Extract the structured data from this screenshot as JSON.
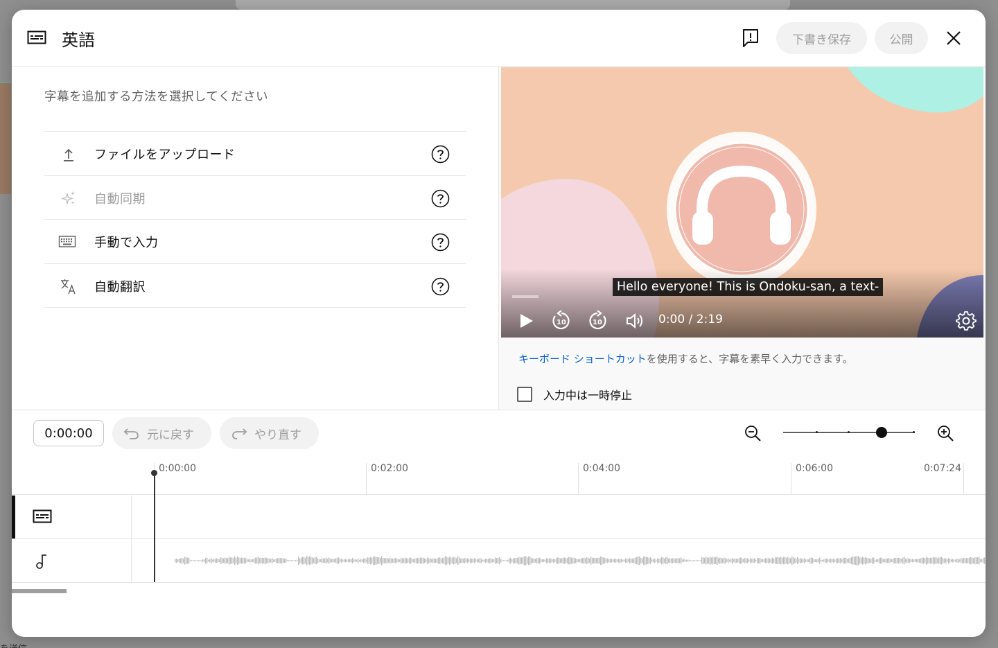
{
  "background": {
    "bottom_text": "を送信"
  },
  "header": {
    "title": "英語",
    "save_draft_label": "下書き保存",
    "publish_label": "公開"
  },
  "left_panel": {
    "heading": "字幕を追加する方法を選択してください",
    "methods": [
      {
        "label": "ファイルをアップロード",
        "icon": "upload-icon",
        "enabled": true
      },
      {
        "label": "自動同期",
        "icon": "sparkle-icon",
        "enabled": false
      },
      {
        "label": "手動で入力",
        "icon": "keyboard-icon",
        "enabled": true
      },
      {
        "label": "自動翻訳",
        "icon": "translate-icon",
        "enabled": true
      }
    ]
  },
  "player": {
    "caption": "Hello everyone! This is Ondoku-san, a text-",
    "time": "0:00 / 2:19",
    "skip_back_seconds": "10",
    "skip_forward_seconds": "10"
  },
  "right_panel": {
    "shortcut_link": "キーボード ショートカット",
    "shortcut_rest": "を使用すると、字幕を素早く入力できます。",
    "pause_label": "入力中は一時停止",
    "pause_checked": false
  },
  "timeline": {
    "current_time": "0:00:00",
    "undo_label": "元に戻す",
    "redo_label": "やり直す",
    "ticks": [
      "0:00:00",
      "0:02:00",
      "0:04:00",
      "0:06:00",
      "0:07:24"
    ]
  },
  "colors": {
    "link": "#065fd4",
    "video_bg": "#f5c9ad",
    "teal_blob": "#aef0e4",
    "pink_circle": "#f0b9ab"
  }
}
